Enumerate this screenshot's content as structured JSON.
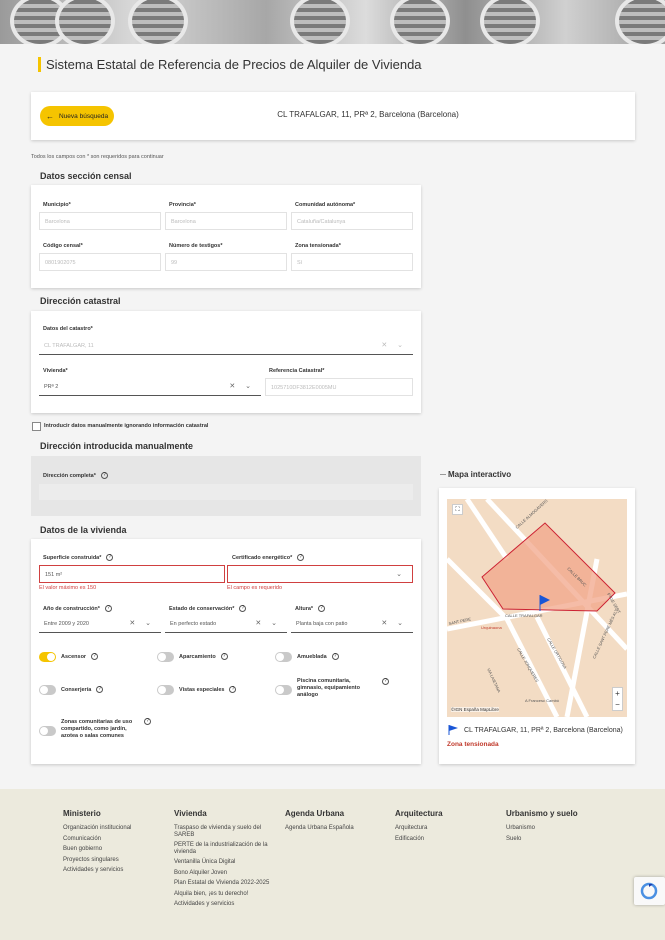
{
  "header": {
    "title": "Sistema Estatal de Referencia de Precios de Alquiler de Vivienda"
  },
  "search": {
    "new_search": "Nueva búsqueda",
    "address": "CL TRAFALGAR, 11, PRª 2, Barcelona (Barcelona)"
  },
  "required_note": "Todos los campos con * son requeridos para continuar",
  "census": {
    "title": "Datos sección censal",
    "municipio_label": "Municipio*",
    "municipio": "Barcelona",
    "provincia_label": "Provincia*",
    "provincia": "Barcelona",
    "comunidad_label": "Comunidad autónoma*",
    "comunidad": "Cataluña/Catalunya",
    "codigo_label": "Código censal*",
    "codigo": "0801902075",
    "testigos_label": "Número de testigos*",
    "testigos": "99",
    "zona_label": "Zona tensionada*",
    "zona": "Sí"
  },
  "catastral": {
    "title": "Dirección catastral",
    "datos_label": "Datos del catastro*",
    "datos": "CL TRAFALGAR, 11",
    "vivienda_label": "Vivienda*",
    "vivienda": "PRª 2",
    "ref_label": "Referencia Catastral*",
    "ref": "1025710DF3812E0005MU"
  },
  "manual_check": "Introducir datos manualmente ignorando información catastral",
  "manual": {
    "title": "Dirección introducida manualmente",
    "full_label": "Dirección completa*"
  },
  "vivienda": {
    "title": "Datos de la vivienda",
    "superficie_label": "Superficie construida*",
    "superficie": "151  m²",
    "superficie_error": "El valor máximo es 150",
    "certificado_label": "Certificado energético*",
    "certificado_error": "El campo es requerido",
    "anio_label": "Año de construcción*",
    "anio": "Entre 2009 y 2020",
    "estado_label": "Estado de conservación*",
    "estado": "En perfecto estado",
    "altura_label": "Altura*",
    "altura": "Planta baja con patio",
    "ascensor": "Ascensor",
    "aparcamiento": "Aparcamiento",
    "amueblada": "Amueblada",
    "conserjeria": "Conserjería",
    "vistas": "Vistas especiales",
    "piscina": "Piscina comunitaria, gimnasio, equipamiento análogo",
    "zonas": "Zonas comunitarias de uso compartido, como jardín, azotea o salas comunes",
    "toggles": {
      "ascensor": true,
      "aparcamiento": false,
      "amueblada": false,
      "conserjeria": false,
      "vistas": false,
      "piscina": false,
      "zonas": false
    }
  },
  "map": {
    "title": "Mapa interactivo",
    "streets": [
      "CALLE ALMOGÀVERS",
      "CALLE BRUC",
      "CALLE TRAFALGAR",
      "CALLE ORTIGOSA",
      "CALLE JONQUERES",
      "VIA LAIETANA",
      "SANT PERE",
      "PTGE SERT",
      "CALLE SANT PERE MÉS ALT",
      "Urquinaona",
      "A Francesc Cambó"
    ],
    "attribution": "©IGN España  MapLibre",
    "address": "CL TRAFALGAR, 11, PRª 2, Barcelona (Barcelona)",
    "zone": "Zona tensionada",
    "zoom_in": "+",
    "zoom_out": "−"
  },
  "footer": {
    "columns": [
      {
        "title": "Ministerio",
        "items": [
          "Organización institucional",
          "Comunicación",
          "Buen gobierno",
          "Proyectos singulares",
          "Actividades y servicios"
        ]
      },
      {
        "title": "Vivienda",
        "items": [
          "Traspaso de vivienda y suelo del SAREB",
          "PERTE de la industrialización de la vivienda",
          "Ventanilla Única Digital",
          "Bono Alquiler Joven",
          "Plan Estatal de Vivienda 2022-2025",
          "Alquila bien, ¡es tu derecho!",
          "Actividades y servicios"
        ]
      },
      {
        "title": "Agenda Urbana",
        "items": [
          "Agenda Urbana Española"
        ]
      },
      {
        "title": "Arquitectura",
        "items": [
          "Arquitectura",
          "Edificación"
        ]
      },
      {
        "title": "Urbanismo y suelo",
        "items": [
          "Urbanismo",
          "Suelo"
        ]
      }
    ]
  },
  "colors": {
    "accent": "#f5c400",
    "error": "#d04040",
    "zone": "#c0392b",
    "map_area": "#f4a98a"
  }
}
